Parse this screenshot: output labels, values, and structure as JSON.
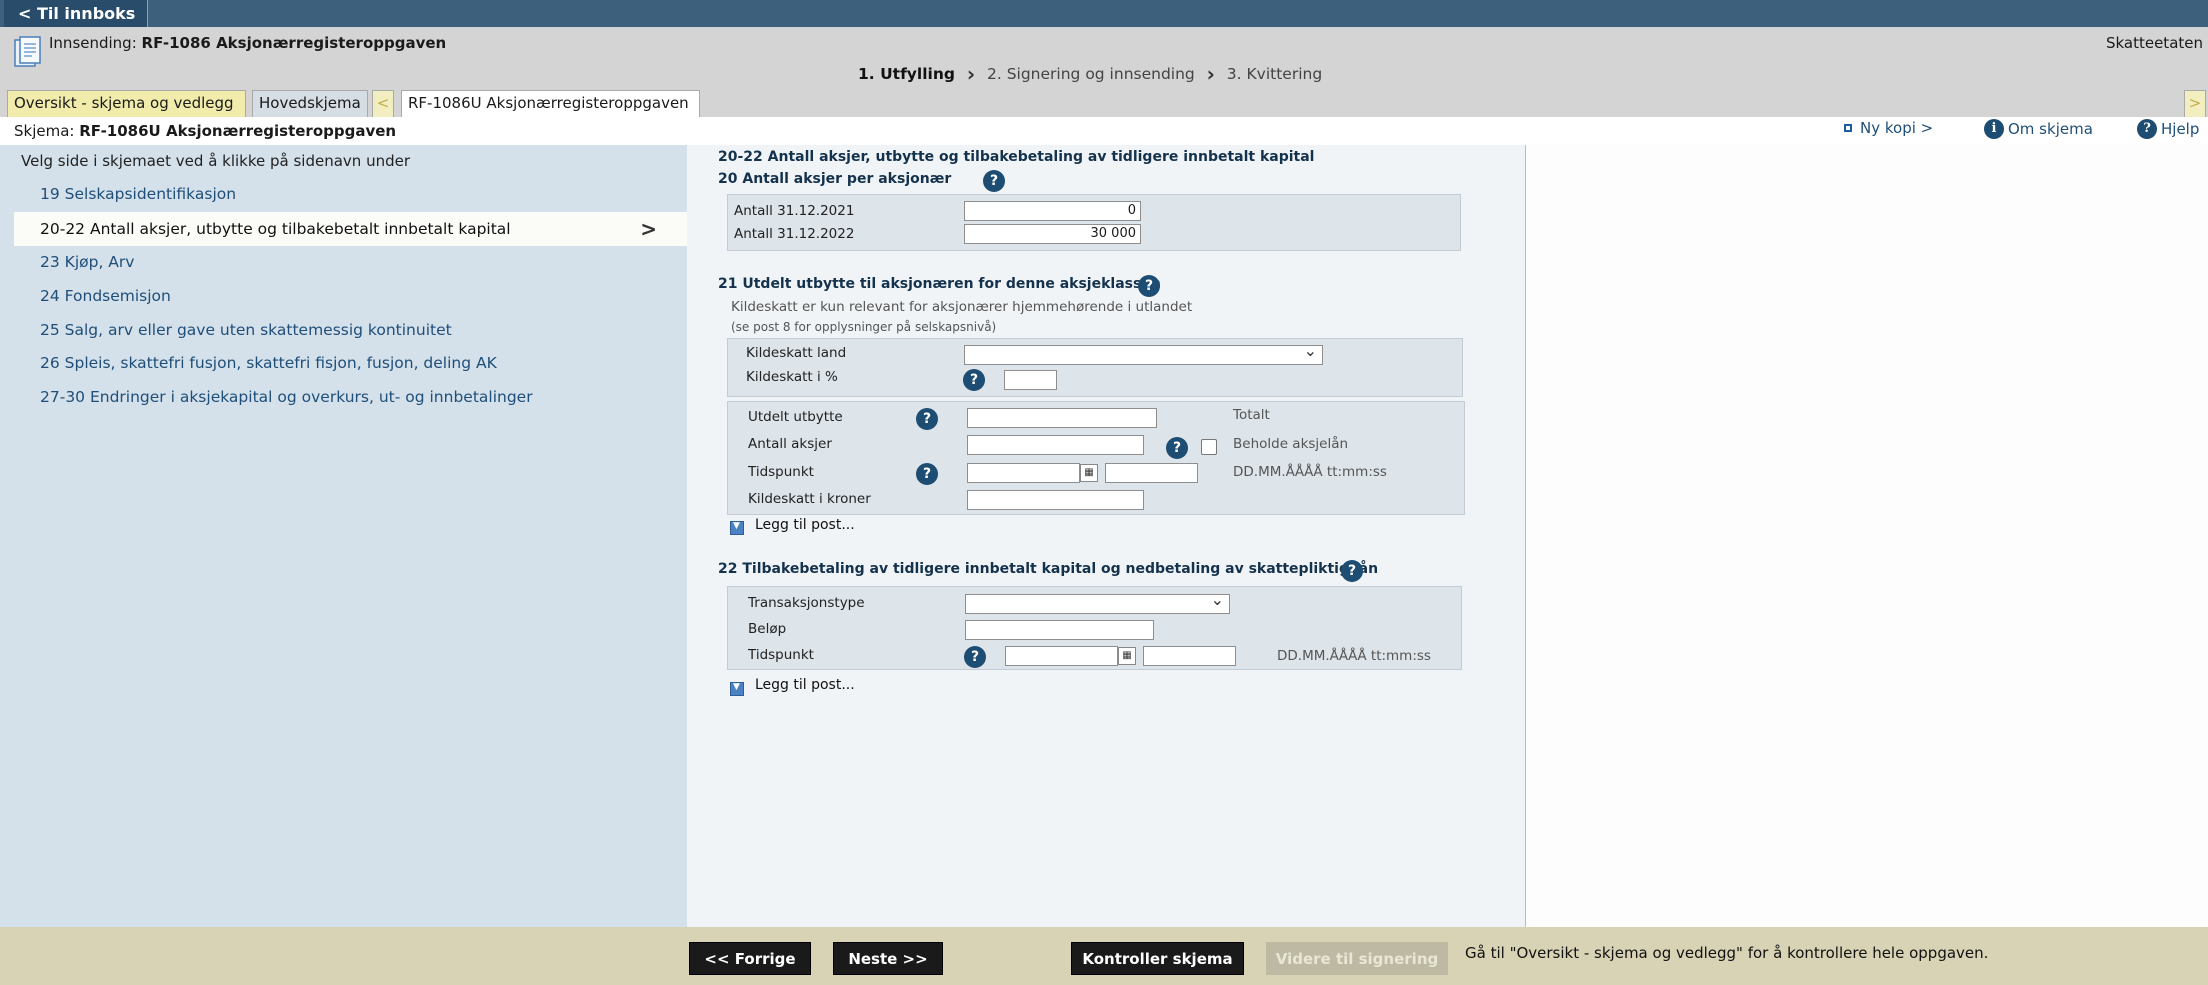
{
  "topbar": {
    "back_label": "< Til innboks"
  },
  "header": {
    "innsending_prefix": "Innsending:",
    "innsending_title": "RF-1086 Aksjonærregisteroppgaven",
    "agency": "Skatteetaten",
    "steps": [
      "1. Utfylling",
      "2. Signering og innsending",
      "3. Kvittering"
    ]
  },
  "tabs": {
    "oversikt": "Oversikt - skjema og vedlegg",
    "hoved": "Hovedskjema",
    "left_arrow": "<",
    "active": "RF-1086U Aksjonærregisteroppgaven",
    "right_arrow": ">"
  },
  "schemabar": {
    "prefix": "Skjema:",
    "title": "RF-1086U Aksjonærregisteroppgaven",
    "ny_kopi": "Ny kopi >",
    "om_skjema": "Om skjema",
    "hjelp": "Hjelp"
  },
  "nav": {
    "hint": "Velg side i skjemaet ved å klikke på sidenavn under",
    "items": [
      "19 Selskapsidentifikasjon",
      "20-22 Antall aksjer, utbytte og tilbakebetalt innbetalt kapital",
      "23 Kjøp, Arv",
      "24 Fondsemisjon",
      "25 Salg, arv eller gave uten skattemessig kontinuitet",
      "26 Spleis, skattefri fusjon, skattefri fisjon, fusjon, deling AK",
      "27-30 Endringer i aksjekapital og overkurs, ut- og innbetalinger"
    ],
    "active_arrow": ">"
  },
  "form": {
    "page_title": "20-22 Antall aksjer, utbytte og tilbakebetaling av tidligere innbetalt kapital",
    "s20": {
      "title": "20 Antall aksjer per aksjonær",
      "label_2021": "Antall 31.12.2021",
      "value_2021": "0",
      "label_2022": "Antall 31.12.2022",
      "value_2022": "30 000"
    },
    "s21": {
      "title": "21 Utdelt utbytte til aksjonæren for denne aksjeklassen",
      "note1": "Kildeskatt er kun relevant for aksjonærer hjemmehørende i utlandet",
      "note2": "(se post 8 for opplysninger på selskapsnivå)",
      "kildeskatt_land": "Kildeskatt land",
      "kildeskatt_pct": "Kildeskatt i %",
      "utdelt_utbytte": "Utdelt utbytte",
      "totalt": "Totalt",
      "antall_aksjer": "Antall aksjer",
      "beholde": "Beholde aksjelån",
      "tidspunkt": "Tidspunkt",
      "date_format": "DD.MM.ÅÅÅÅ tt:mm:ss",
      "kildeskatt_kroner": "Kildeskatt i kroner",
      "legg_til": "Legg til post..."
    },
    "s22": {
      "title": "22 Tilbakebetaling av tidligere innbetalt kapital og nedbetaling av skattepliktig lån",
      "transaksjonstype": "Transaksjonstype",
      "belop": "Beløp",
      "tidspunkt": "Tidspunkt",
      "date_format": "DD.MM.ÅÅÅÅ tt:mm:ss",
      "legg_til": "Legg til post..."
    }
  },
  "footer": {
    "forrige": "<< Forrige",
    "neste": "Neste >>",
    "kontroller": "Kontroller skjema",
    "videre": "Videre til signering",
    "note": "Gå til \"Oversikt - skjema og vedlegg\" for å kontrollere hele oppgaven."
  },
  "colors": {
    "topbar": "#3d607d",
    "nav_bg": "#d4e1ea",
    "footer_bg": "#d8d3b4",
    "link": "#1f4e79"
  }
}
